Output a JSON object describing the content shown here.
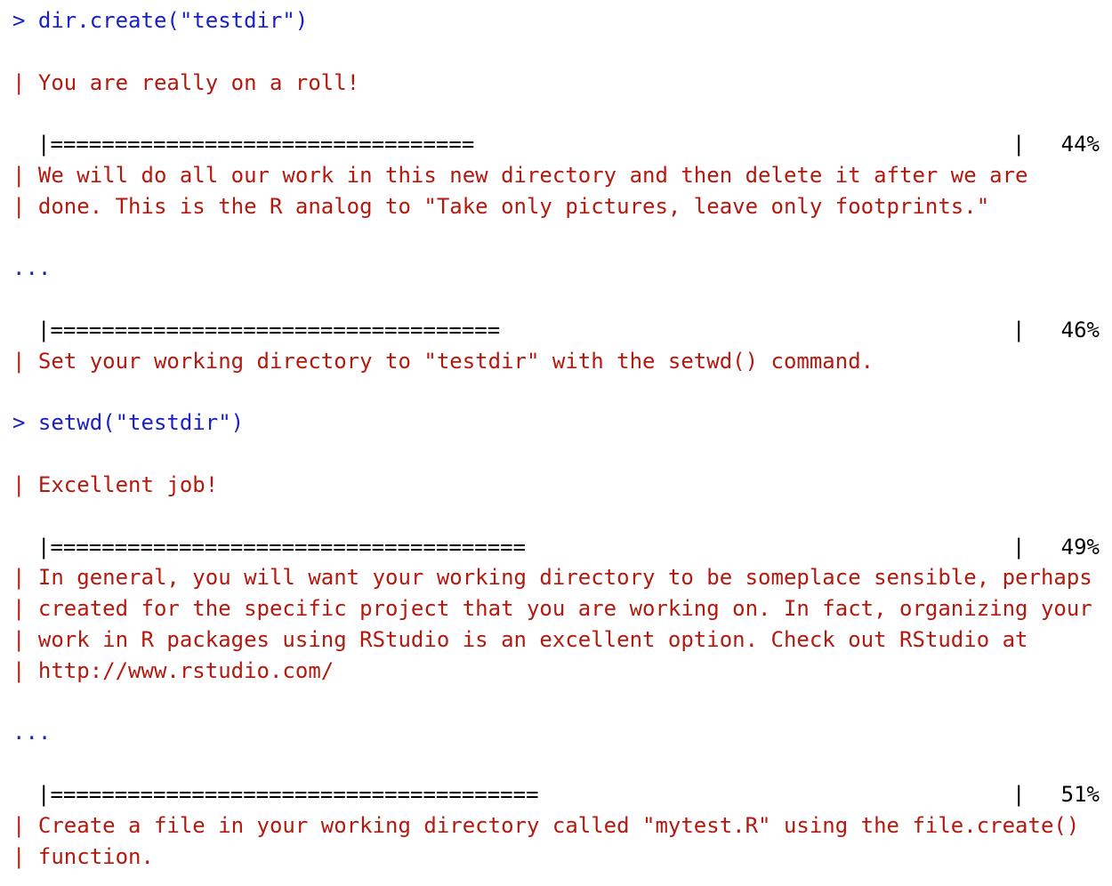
{
  "window": {
    "title": ""
  },
  "colors": {
    "command": "#1a20c8",
    "message": "#b3190f",
    "progress": "#000000",
    "background": "#ffffff"
  },
  "console": {
    "entries": [
      {
        "kind": "command",
        "text": "> dir.create(\"testdir\")"
      },
      {
        "kind": "blank"
      },
      {
        "kind": "message",
        "text": "| You are really on a roll!"
      },
      {
        "kind": "blank"
      },
      {
        "kind": "progress",
        "bar": "|=================================",
        "end": "|",
        "percent_label": "44%",
        "percent": 44
      },
      {
        "kind": "message",
        "text": "| We will do all our work in this new directory and then delete it after we are"
      },
      {
        "kind": "message",
        "text": "| done. This is the R analog to \"Take only pictures, leave only footprints.\""
      },
      {
        "kind": "blank"
      },
      {
        "kind": "dots",
        "text": "..."
      },
      {
        "kind": "blank"
      },
      {
        "kind": "progress",
        "bar": "|===================================",
        "end": "|",
        "percent_label": "46%",
        "percent": 46
      },
      {
        "kind": "message",
        "text": "| Set your working directory to \"testdir\" with the setwd() command."
      },
      {
        "kind": "blank"
      },
      {
        "kind": "command",
        "text": "> setwd(\"testdir\")"
      },
      {
        "kind": "blank"
      },
      {
        "kind": "message",
        "text": "| Excellent job!"
      },
      {
        "kind": "blank"
      },
      {
        "kind": "progress",
        "bar": "|=====================================",
        "end": "|",
        "percent_label": "49%",
        "percent": 49
      },
      {
        "kind": "message",
        "text": "| In general, you will want your working directory to be someplace sensible, perhaps"
      },
      {
        "kind": "message",
        "text": "| created for the specific project that you are working on. In fact, organizing your"
      },
      {
        "kind": "message",
        "text": "| work in R packages using RStudio is an excellent option. Check out RStudio at"
      },
      {
        "kind": "message",
        "text": "| http://www.rstudio.com/"
      },
      {
        "kind": "blank"
      },
      {
        "kind": "dots",
        "text": "..."
      },
      {
        "kind": "blank"
      },
      {
        "kind": "progress",
        "bar": "|======================================",
        "end": "|",
        "percent_label": "51%",
        "percent": 51
      },
      {
        "kind": "message",
        "text": "| Create a file in your working directory called \"mytest.R\" using the file.create()"
      },
      {
        "kind": "message",
        "text": "| function."
      }
    ]
  }
}
